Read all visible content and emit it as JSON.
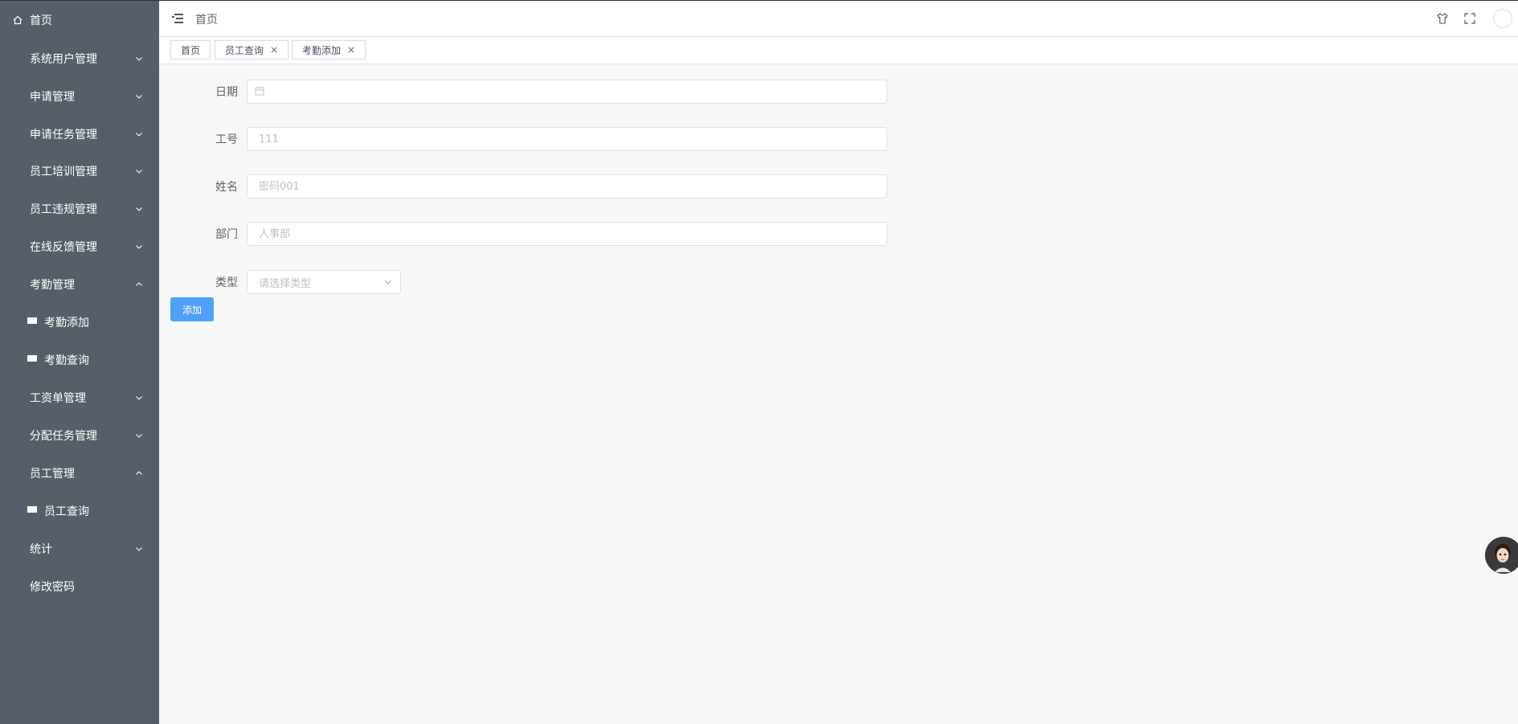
{
  "sidebar": {
    "items": [
      {
        "label": "首页",
        "icon": "home-icon",
        "expandable": false
      },
      {
        "label": "系统用户管理",
        "icon": "grid-icon",
        "expandable": true,
        "expanded": false
      },
      {
        "label": "申请管理",
        "icon": "grid-icon",
        "expandable": true,
        "expanded": false
      },
      {
        "label": "申请任务管理",
        "icon": "grid-icon",
        "expandable": true,
        "expanded": false
      },
      {
        "label": "员工培训管理",
        "icon": "grid-icon",
        "expandable": true,
        "expanded": false
      },
      {
        "label": "员工违规管理",
        "icon": "grid-icon",
        "expandable": true,
        "expanded": false
      },
      {
        "label": "在线反馈管理",
        "icon": "grid-icon",
        "expandable": true,
        "expanded": false
      },
      {
        "label": "考勤管理",
        "icon": "grid-icon",
        "expandable": true,
        "expanded": true
      },
      {
        "label": "考勤添加",
        "icon": "apps-icon",
        "sub": true
      },
      {
        "label": "考勤查询",
        "icon": "apps-icon",
        "sub": true
      },
      {
        "label": "工资单管理",
        "icon": "grid-icon",
        "expandable": true,
        "expanded": false
      },
      {
        "label": "分配任务管理",
        "icon": "grid-icon",
        "expandable": true,
        "expanded": false
      },
      {
        "label": "员工管理",
        "icon": "grid-icon",
        "expandable": true,
        "expanded": true
      },
      {
        "label": "员工查询",
        "icon": "apps-icon",
        "sub": true
      },
      {
        "label": "统计",
        "icon": "grid-icon",
        "expandable": true,
        "expanded": false
      },
      {
        "label": "修改密码",
        "icon": "grid-icon",
        "expandable": false
      }
    ]
  },
  "header": {
    "breadcrumb": "首页",
    "icons": [
      "menu-toggle-icon",
      "theme-shirt-icon",
      "fullscreen-icon",
      "user-avatar"
    ]
  },
  "tags": [
    {
      "label": "首页",
      "closable": false
    },
    {
      "label": "员工查询",
      "closable": true
    },
    {
      "label": "考勤添加",
      "closable": true
    }
  ],
  "tag_close_glyph": "×",
  "form": {
    "date": {
      "label": "日期",
      "value": "",
      "placeholder": ""
    },
    "emp_no": {
      "label": "工号",
      "value": "",
      "placeholder": "111"
    },
    "name": {
      "label": "姓名",
      "value": "",
      "placeholder": "密码001"
    },
    "dept": {
      "label": "部门",
      "value": "",
      "placeholder": "人事部"
    },
    "type": {
      "label": "类型",
      "placeholder": "请选择类型"
    },
    "submit_label": "添加"
  },
  "colors": {
    "sidebar_bg": "#565f69",
    "primary_button": "#4ea2fb",
    "page_bg": "#f7f7f7"
  }
}
